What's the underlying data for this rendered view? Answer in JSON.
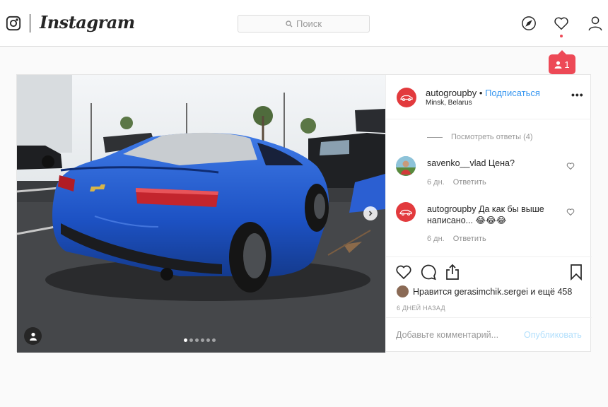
{
  "header": {
    "wordmark": "Instagram",
    "search_placeholder": "Поиск",
    "notification_count": "1"
  },
  "post": {
    "author": "autogroupby",
    "separator": " • ",
    "follow_label": "Подписаться",
    "location": "Minsk, Belarus",
    "more_label": "•••",
    "view_replies": "Посмотреть ответы (4)",
    "comments": [
      {
        "user": "savenko__vlad",
        "text": "Цена?",
        "age": "6 дн.",
        "reply_label": "Ответить"
      },
      {
        "user": "autogroupby",
        "text": "Да как бы выше написано... 😂😂😂",
        "age": "6 дн.",
        "reply_label": "Ответить"
      }
    ],
    "likes_prefix": "Нравится ",
    "likes_user": "gerasimchik.sergei",
    "likes_suffix": " и ещё 458",
    "time_ago": "6 ДНЕЙ НАЗАД",
    "comment_placeholder": "Добавьте комментарий...",
    "publish_label": "Опубликовать",
    "carousel": {
      "count": 6,
      "active_index": 0
    }
  },
  "colors": {
    "accent": "#3897f0",
    "notification": "#ed4956",
    "brand_avatar": "#e23a3d",
    "car": "#1d52c4"
  }
}
